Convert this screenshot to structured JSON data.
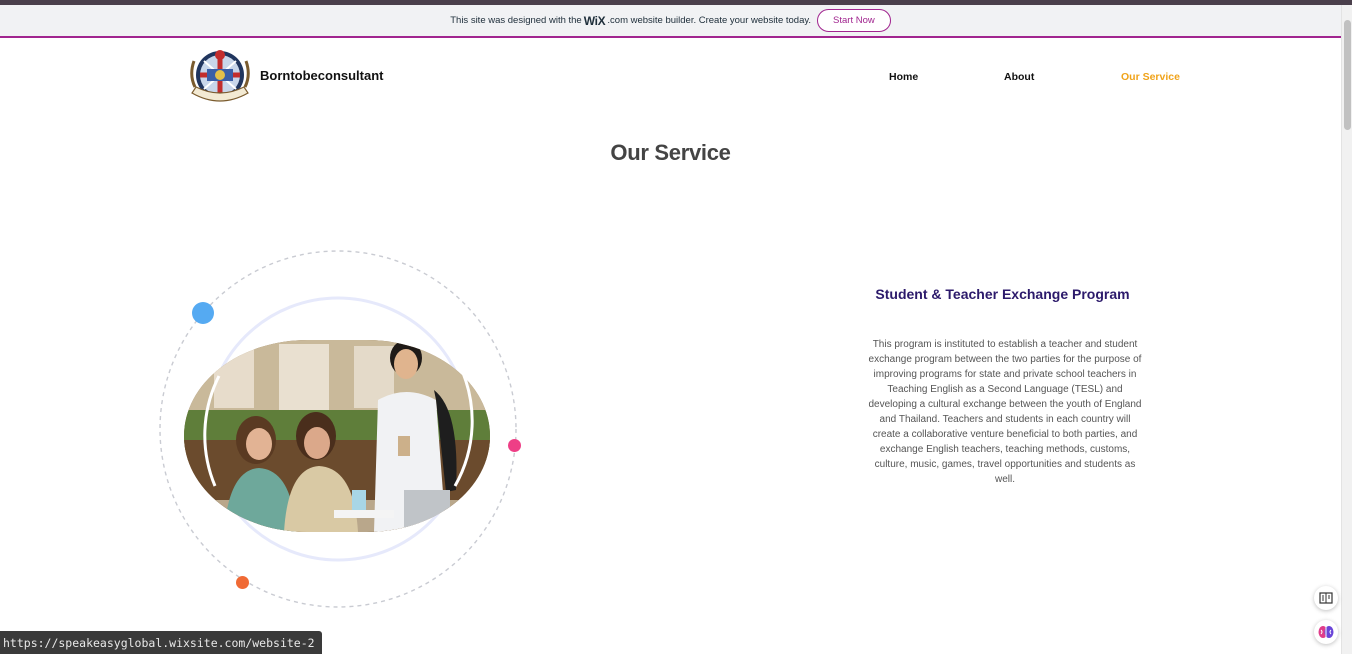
{
  "wix_banner": {
    "text_before": "This site was designed with the",
    "wix_logo": "WiX",
    "text_after": ".com website builder. Create your website today.",
    "button_label": "Start Now"
  },
  "header": {
    "site_name": "Borntobeconsultant",
    "nav": [
      {
        "label": "Home"
      },
      {
        "label": "About"
      },
      {
        "label": "Our Service"
      }
    ]
  },
  "page_title": "Our Service",
  "service": {
    "title": "Student & Teacher Exchange Program",
    "description": "This program is instituted to establish a teacher and student exchange program between the two parties for the purpose of improving programs for state and private school teachers in Teaching English as a Second Language (TESL) and developing a cultural exchange between the youth of England and Thailand. Teachers and students in each country will create a collaborative venture beneficial to both parties, and exchange English teachers, teaching methods, customs, culture, music, games, travel opportunities and students as well."
  },
  "status_bar": {
    "url": "https://speakeasyglobal.wixsite.com/website-2"
  },
  "colors": {
    "wix_accent": "#a1258f",
    "nav_active": "#f0a31a",
    "service_title": "#2c1a6b",
    "dot_blue": "#55aaf2",
    "dot_pink": "#ee3f86",
    "dot_orange": "#f06a35"
  },
  "icons": {
    "reader": "reader-mode-icon",
    "assistant": "brain-icon"
  }
}
